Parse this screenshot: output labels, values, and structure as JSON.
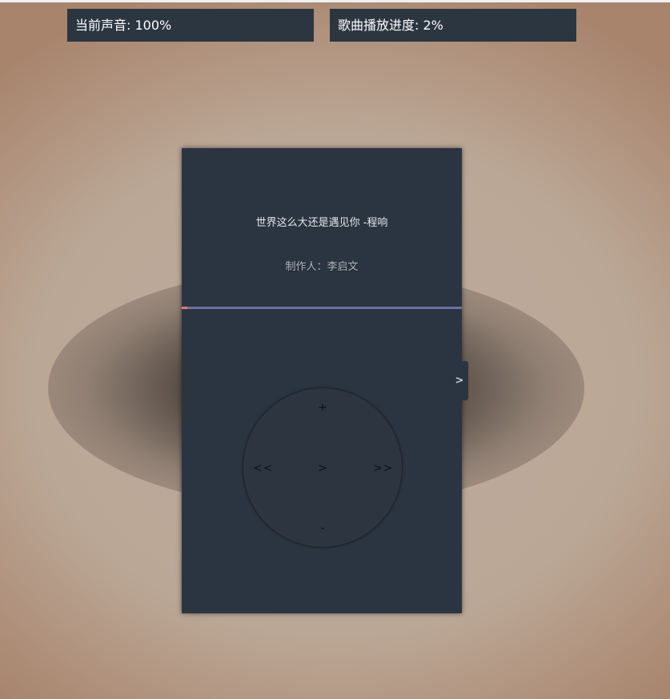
{
  "status": {
    "volume_text": "当前声音: 100%",
    "progress_text": "歌曲播放进度: 2%"
  },
  "player": {
    "song_title": "世界这么大还是遇见你 -程响",
    "producer": "制作人：李启文",
    "progress_fraction": 0.02,
    "side_toggle_label": ">"
  },
  "controls": {
    "volume_up": "+",
    "volume_down": "-",
    "previous": "<<",
    "play": ">",
    "next": ">>"
  },
  "colors": {
    "panel": "#2b3541",
    "progress_track": "#6f6f9f",
    "progress_fill": "#e07b7b"
  }
}
